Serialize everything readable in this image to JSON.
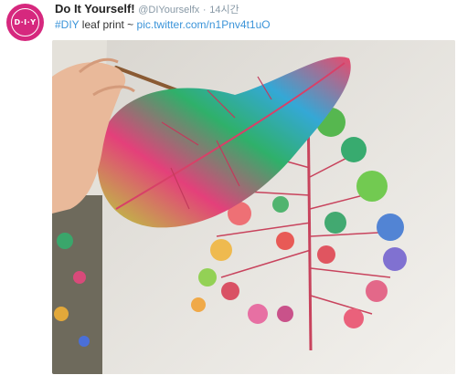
{
  "tweet": {
    "avatar_text": "D·I·Y",
    "display_name": "Do It Yourself!",
    "handle": "@DIYourselfx",
    "separator": "·",
    "timestamp": "14시간",
    "hashtag": "#DIY",
    "text": " leaf print ~ ",
    "link": "pic.twitter.com/n1Pnv4t1uO"
  },
  "colors": {
    "avatar_bg": "#d6287e",
    "link": "#3b94d9"
  }
}
